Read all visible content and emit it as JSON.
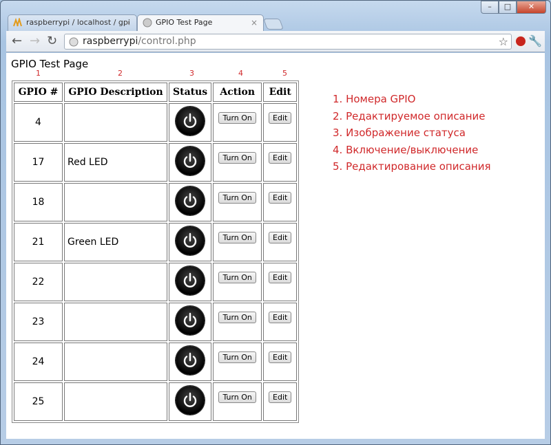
{
  "browser": {
    "tabs": [
      {
        "title": "raspberrypi / localhost / gpi",
        "active": false,
        "icon": "pma-icon"
      },
      {
        "title": "GPIO Test Page",
        "active": true,
        "icon": "globe-icon"
      }
    ],
    "url_host": "raspberrypi",
    "url_path": "/control.php"
  },
  "page": {
    "title": "GPIO Test Page",
    "column_numbers": [
      "1",
      "2",
      "3",
      "4",
      "5"
    ],
    "headers": [
      "GPIO #",
      "GPIO Description",
      "Status",
      "Action",
      "Edit"
    ],
    "rows": [
      {
        "gpio": "4",
        "description": "",
        "status": "off",
        "action": "Turn On",
        "edit": "Edit"
      },
      {
        "gpio": "17",
        "description": "Red LED",
        "status": "off",
        "action": "Turn On",
        "edit": "Edit"
      },
      {
        "gpio": "18",
        "description": "",
        "status": "off",
        "action": "Turn On",
        "edit": "Edit"
      },
      {
        "gpio": "21",
        "description": "Green LED",
        "status": "off",
        "action": "Turn On",
        "edit": "Edit"
      },
      {
        "gpio": "22",
        "description": "",
        "status": "off",
        "action": "Turn On",
        "edit": "Edit"
      },
      {
        "gpio": "23",
        "description": "",
        "status": "off",
        "action": "Turn On",
        "edit": "Edit"
      },
      {
        "gpio": "24",
        "description": "",
        "status": "off",
        "action": "Turn On",
        "edit": "Edit"
      },
      {
        "gpio": "25",
        "description": "",
        "status": "off",
        "action": "Turn On",
        "edit": "Edit"
      }
    ]
  },
  "annotations": [
    "1. Номера GPIO",
    "2. Редактируемое описание",
    "3. Изображение статуса",
    "4. Включение/выключение",
    "5. Редактирование описания"
  ],
  "colors": {
    "annotation": "#d0282a"
  }
}
